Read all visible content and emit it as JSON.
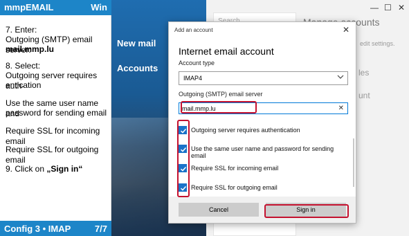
{
  "guide": {
    "header_title": "mmpEMAIL",
    "header_right": "Win",
    "step7_a": "7.    Enter:",
    "step7_b": "Outgoing (SMTP) email server:",
    "step7_c": "mail.mmp.lu",
    "step8_a": "8.    Select:",
    "step8_b": "Outgoing server requires auth-",
    "step8_c": "entication",
    "step8_d": "Use the same user name and",
    "step8_e": "password for sending email",
    "step8_f": "Require SSL for incoming email",
    "step8_g": "Require SSL for outgoing email",
    "step9_a": "9.    Click on ",
    "step9_b": "„Sign in“",
    "footer_left": "Config 3 • IMAP",
    "footer_right": "7/7"
  },
  "mail": {
    "nav_new": "New mail",
    "nav_accounts": "Accounts",
    "manage_title": "Manage accounts",
    "edit_text": "edit settings.",
    "ghost_1": "les",
    "ghost_2": "unt",
    "search_ghost": "Search"
  },
  "dialog": {
    "title": "Add an account",
    "heading": "Internet email account",
    "account_type_label": "Account type",
    "account_type_value": "IMAP4",
    "smtp_label": "Outgoing (SMTP) email server",
    "smtp_value": "mail.mmp.lu",
    "checks": [
      {
        "label": "Outgoing server requires authentication",
        "checked": true
      },
      {
        "label": "Use the same user name and password for sending email",
        "checked": true
      },
      {
        "label": "Require SSL for incoming email",
        "checked": true
      },
      {
        "label": "Require SSL for outgoing email",
        "checked": true
      }
    ],
    "cancel_label": "Cancel",
    "signin_label": "Sign in"
  },
  "colors": {
    "accent": "#1d85c8",
    "checkbox": "#1a73c9",
    "highlight": "#c4112f"
  }
}
